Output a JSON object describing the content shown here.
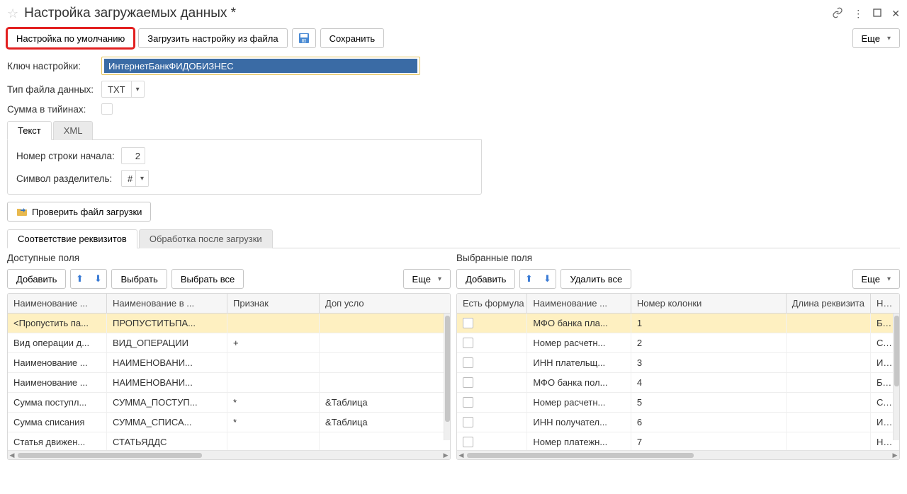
{
  "title": "Настройка загружаемых данных *",
  "toolbar": {
    "default_settings": "Настройка по умолчанию",
    "load_from_file": "Загрузить настройку из файла",
    "save": "Сохранить",
    "more": "Еще"
  },
  "form": {
    "key_label": "Ключ настройки:",
    "key_value": "ИнтернетБанкФИДОБИЗНЕС",
    "file_type_label": "Тип файла данных:",
    "file_type_value": "TXT",
    "sum_tiyin_label": "Сумма в тийинах:"
  },
  "format_tabs": {
    "text": "Текст",
    "xml": "XML"
  },
  "format_panel": {
    "start_row_label": "Номер строки начала:",
    "start_row_value": "2",
    "delimiter_label": "Символ разделитель:",
    "delimiter_value": "#"
  },
  "check_file_btn": "Проверить файл загрузки",
  "mapping_tabs": {
    "map": "Соответствие реквизитов",
    "post": "Обработка после загрузки"
  },
  "left": {
    "title": "Доступные поля",
    "add_btn": "Добавить",
    "select_btn": "Выбрать",
    "select_all_btn": "Выбрать все",
    "more_btn": "Еще",
    "columns": [
      "Наименование ...",
      "Наименование в ...",
      "Признак",
      "Доп усло"
    ],
    "rows": [
      {
        "c1": "<Пропустить па...",
        "c2": "ПРОПУСТИТЬПА...",
        "c3": "",
        "c4": "",
        "selected": true
      },
      {
        "c1": "Вид операции д...",
        "c2": "ВИД_ОПЕРАЦИИ",
        "c3": "+",
        "c4": ""
      },
      {
        "c1": "Наименование ...",
        "c2": "НАИМЕНОВАНИ...",
        "c3": "",
        "c4": ""
      },
      {
        "c1": "Наименование ...",
        "c2": "НАИМЕНОВАНИ...",
        "c3": "",
        "c4": ""
      },
      {
        "c1": "Сумма поступл...",
        "c2": "СУММА_ПОСТУП...",
        "c3": "*",
        "c4": "&Таблица"
      },
      {
        "c1": "Сумма списания",
        "c2": "СУММА_СПИСА...",
        "c3": "*",
        "c4": "&Таблица"
      },
      {
        "c1": "Статья движен...",
        "c2": "СТАТЬЯДДС",
        "c3": "",
        "c4": ""
      }
    ]
  },
  "right": {
    "title": "Выбранные поля",
    "add_btn": "Добавить",
    "delete_all_btn": "Удалить все",
    "more_btn": "Еще",
    "columns": [
      "Есть формула",
      "Наименование ...",
      "Номер колонки",
      "Длина реквизита",
      "Наим"
    ],
    "rows": [
      {
        "c2": "МФО банка пла...",
        "c3": "1",
        "c5": "БАН",
        "selected": true
      },
      {
        "c2": "Номер расчетн...",
        "c3": "2",
        "c5": "СЧЕТ"
      },
      {
        "c2": "ИНН плательщ...",
        "c3": "3",
        "c5": "ИНН"
      },
      {
        "c2": "МФО банка пол...",
        "c3": "4",
        "c5": "БАН"
      },
      {
        "c2": "Номер расчетн...",
        "c3": "5",
        "c5": "СЧЕТ"
      },
      {
        "c2": "ИНН получател...",
        "c3": "6",
        "c5": "ИНН"
      },
      {
        "c2": "Номер платежн...",
        "c3": "7",
        "c5": "НОМ"
      }
    ]
  }
}
